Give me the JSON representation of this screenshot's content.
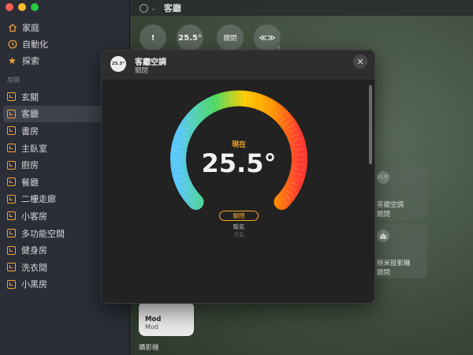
{
  "sidebar": {
    "nav": [
      {
        "label": "家庭",
        "icon": "house-icon"
      },
      {
        "label": "自動化",
        "icon": "clock-icon"
      },
      {
        "label": "探索",
        "icon": "star-icon"
      }
    ],
    "section_label": "房間",
    "rooms": [
      {
        "label": "玄關"
      },
      {
        "label": "客廳"
      },
      {
        "label": "書房"
      },
      {
        "label": "主臥室"
      },
      {
        "label": "廚房"
      },
      {
        "label": "餐廳"
      },
      {
        "label": "二樓走廊"
      },
      {
        "label": "小客房"
      },
      {
        "label": "多功能空間"
      },
      {
        "label": "健身房"
      },
      {
        "label": "洗衣間"
      },
      {
        "label": "小黑房"
      }
    ],
    "active_room_index": 1
  },
  "main": {
    "title": "客廳",
    "status_buttons": [
      "!",
      "25.5°",
      "關閉",
      "≪≫"
    ],
    "tiles": [
      {
        "icon_text": "25.5°",
        "name": "客廳空調",
        "state": "關閉"
      },
      {
        "name": "極米投影機",
        "state": "關閉"
      }
    ],
    "light_tile": {
      "name": "Mod",
      "state": "Mod"
    },
    "camera_section": "攝影機"
  },
  "modal": {
    "badge": "25.5°",
    "title": "客廳空調",
    "subtitle": "關閉",
    "close_label": "✕",
    "now_label": "現在",
    "temperature": "25.5°",
    "modes": {
      "selected": "關閉",
      "heat": "暖氣",
      "cool": "冷氣"
    },
    "dial_colors": [
      "#5ac8fa",
      "#4cd964",
      "#ffcc00",
      "#ff9500",
      "#ff3b30"
    ]
  },
  "window": {
    "traffic_lights": [
      "#fe5f57",
      "#febc2e",
      "#28c840"
    ]
  }
}
